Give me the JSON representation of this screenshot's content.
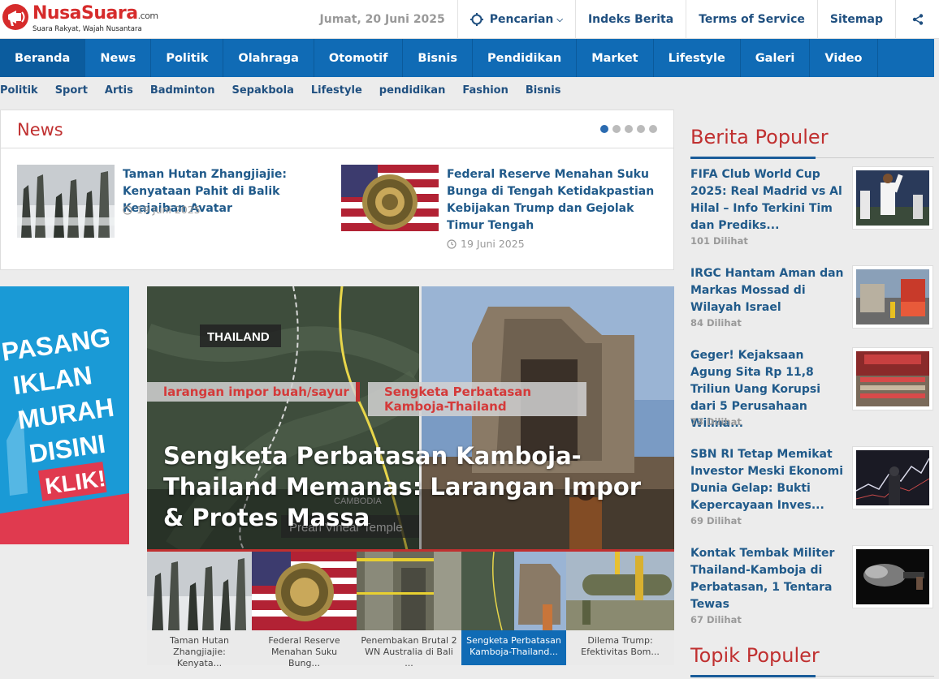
{
  "header": {
    "logo_name_1": "Nusa",
    "logo_name_2": "Suara",
    "logo_tld": ".com",
    "logo_tagline": "Suara Rakyat, Wajah Nusantara",
    "date": "Jumat, 20 Juni 2025",
    "search_label": "Pencarian",
    "links": [
      "Indeks Berita",
      "Terms of Service",
      "Sitemap"
    ]
  },
  "mainnav": [
    "Beranda",
    "News",
    "Politik",
    "Olahraga",
    "Otomotif",
    "Bisnis",
    "Pendidikan",
    "Market",
    "Lifestyle",
    "Galeri",
    "Video"
  ],
  "subnav": [
    "Politik",
    "Sport",
    "Artis",
    "Badminton",
    "Sepakbola",
    "Lifestyle",
    "pendidikan",
    "Fashion",
    "Bisnis"
  ],
  "newsbox": {
    "title": "News",
    "slide_count": 5,
    "active_slide": 1,
    "items": [
      {
        "title": "Taman Hutan Zhangjiajie: Kenyataan Pahit di Balik Keajaiban Avatar",
        "date": "19 Juni 2025"
      },
      {
        "title": "Federal Reserve Menahan Suku Bunga di Tengah Ketidakpastian Kebijakan Trump dan Gejolak Timur Tengah",
        "date": "19 Juni 2025"
      }
    ]
  },
  "ad": {
    "lines": [
      "PASANG",
      "IKLAN",
      "MURAH",
      "DISINI"
    ],
    "cta": "KLIK!"
  },
  "hero": {
    "tags": [
      "larangan impor buah/sayur",
      "Sengketa Perbatasan Kamboja-Thailand"
    ],
    "title": "Sengketa Perbatasan Kamboja-Thailand Memanas: Larangan Impor & Protes Massa",
    "map_label_1": "THAILAND",
    "map_label_2": "CAMBODIA",
    "map_label_3": "Preah Vihear Temple"
  },
  "strip": [
    {
      "caption": "Taman Hutan Zhangjiajie: Kenyata..."
    },
    {
      "caption": "Federal Reserve Menahan Suku Bung..."
    },
    {
      "caption": "Penembakan Brutal 2 WN Australia di Bali ..."
    },
    {
      "caption": "Sengketa Perbatasan Kamboja-Thailand..."
    },
    {
      "caption": "Dilema Trump: Efektivitas Bom..."
    }
  ],
  "sidebar": {
    "popular_title": "Berita Populer",
    "topics_title": "Topik Populer",
    "popular": [
      {
        "title": "FIFA Club World Cup 2025: Real Madrid vs Al Hilal – Info Terkini Tim dan Prediks...",
        "views": "101 Dilihat"
      },
      {
        "title": "IRGC Hantam Aman dan Markas Mossad di Wilayah Israel",
        "views": "84 Dilihat"
      },
      {
        "title": "Geger! Kejaksaan Agung Sita Rp 11,8 Triliun Uang Korupsi dari 5 Perusahaan Wilma...",
        "views": "73 Dilihat"
      },
      {
        "title": "SBN RI Tetap Memikat Investor Meski Ekonomi Dunia Gelap: Bukti Kepercayaan Inves...",
        "views": "69 Dilihat"
      },
      {
        "title": "Kontak Tembak Militer Thailand-Kamboja di Perbatasan, 1 Tentara Tewas",
        "views": "67 Dilihat"
      }
    ]
  },
  "colors": {
    "brand_red": "#d62b2b",
    "nav_blue": "#106bb5",
    "link_blue": "#205a8a"
  }
}
